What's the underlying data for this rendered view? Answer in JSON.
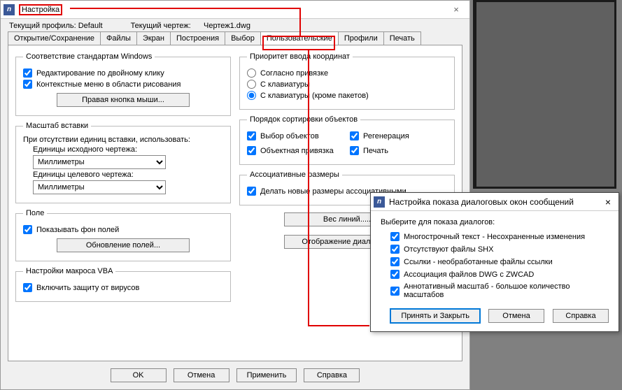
{
  "window": {
    "title": "Настройка",
    "close_glyph": "×",
    "app_icon_text": "n"
  },
  "profile": {
    "current_profile_label": "Текущий профиль:",
    "current_profile_value": "Default",
    "current_drawing_label": "Текущий чертеж:",
    "current_drawing_value": "Чертеж1.dwg"
  },
  "tabs": [
    {
      "label": "Открытие/Сохранение"
    },
    {
      "label": "Файлы"
    },
    {
      "label": "Экран"
    },
    {
      "label": "Построения"
    },
    {
      "label": "Выбор"
    },
    {
      "label": "Пользовательские"
    },
    {
      "label": "Профили"
    },
    {
      "label": "Печать"
    }
  ],
  "left": {
    "std": {
      "legend": "Соответствие стандартам Windows",
      "dblclick": "Редактирование по двойному клику",
      "context": "Контекстные меню в области рисования",
      "rmb_btn": "Правая кнопка мыши..."
    },
    "ins": {
      "legend": "Масштаб вставки",
      "sentence": "При отсутствии единиц вставки, использовать:",
      "src_label": "Единицы исходного чертежа:",
      "src_value": "Миллиметры",
      "dst_label": "Единицы целевого чертежа:",
      "dst_value": "Миллиметры"
    },
    "fld": {
      "legend": "Поле",
      "show_bg": "Показывать фон полей",
      "update_btn": "Обновление полей..."
    },
    "vba": {
      "legend": "Настройки макроса VBA",
      "virus": "Включить защиту от вирусов"
    }
  },
  "right": {
    "coord": {
      "legend": "Приоритет ввода координат",
      "r1": "Согласно привязке",
      "r2": "С клавиатуры",
      "r3": "С клавиатуры (кроме пакетов)"
    },
    "sort": {
      "legend": "Порядок сортировки объектов",
      "c1": "Выбор объектов",
      "c2": "Регенерация",
      "c3": "Объектная привязка",
      "c4": "Печать"
    },
    "assoc": {
      "legend": "Ассоциативные размеры",
      "chk": "Делать новые размеры ассоциативными"
    },
    "lw_btn": "Вес линий.....",
    "dlg_btn": "Отображение диалогов..."
  },
  "footer": {
    "ok": "OK",
    "cancel": "Отмена",
    "apply": "Применить",
    "help": "Справка"
  },
  "dialog2": {
    "title": "Настройка показа диалоговых окон сообщений",
    "close_glyph": "×",
    "instruction": "Выберите для показа диалогов:",
    "items": [
      "Многострочный текст - Несохраненные изменения",
      "Отсутствуют файлы SHX",
      "Ссылки - необработанные файлы ссылки",
      "Ассоциация файлов DWG с ZWCAD",
      "Аннотативный масштаб - большое количество масштабов"
    ],
    "accept": "Принять и Закрыть",
    "cancel": "Отмена",
    "help": "Справка"
  }
}
